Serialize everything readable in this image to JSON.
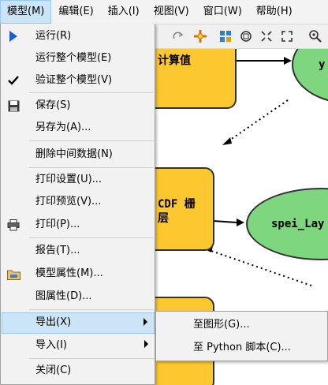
{
  "menubar": {
    "items": [
      {
        "label": "模型(M)"
      },
      {
        "label": "编辑(E)"
      },
      {
        "label": "插入(I)"
      },
      {
        "label": "视图(V)"
      },
      {
        "label": "窗口(W)"
      },
      {
        "label": "帮助(H)"
      }
    ]
  },
  "toolbar": {
    "icons": [
      "redo-icon",
      "add-data-icon",
      "layout-icon",
      "full-extent-icon",
      "shrink-icon",
      "expand-icon",
      "zoom-in-icon"
    ]
  },
  "canvas": {
    "nodes": {
      "calc_text": "计算值",
      "ellipse_top_text": "y",
      "netcdf_text_1": "CDF 栅",
      "netcdf_text_2": "层",
      "spei_text": "spei_Lay"
    },
    "colors": {
      "process": "#fcc72f",
      "data": "#7ed67e"
    }
  },
  "menu": {
    "items": {
      "run": "运行(R)",
      "run_all": "运行整个模型(E)",
      "validate": "验证整个模型(V)",
      "save": "保存(S)",
      "save_as": "另存为(A)...",
      "delete_intermediate": "删除中间数据(N)",
      "print_setup": "打印设置(U)...",
      "print_preview": "打印预览(V)...",
      "print": "打印(P)...",
      "report": "报告(T)...",
      "model_properties": "模型属性(M)...",
      "diagram_properties": "图属性(D)...",
      "export": "导出(X)",
      "import": "导入(I)",
      "close": "关闭(C)"
    },
    "highlight_color": "#cce4f7"
  },
  "submenu": {
    "to_graphic": "至图形(G)...",
    "to_python": "至 Python 脚本(C)..."
  }
}
